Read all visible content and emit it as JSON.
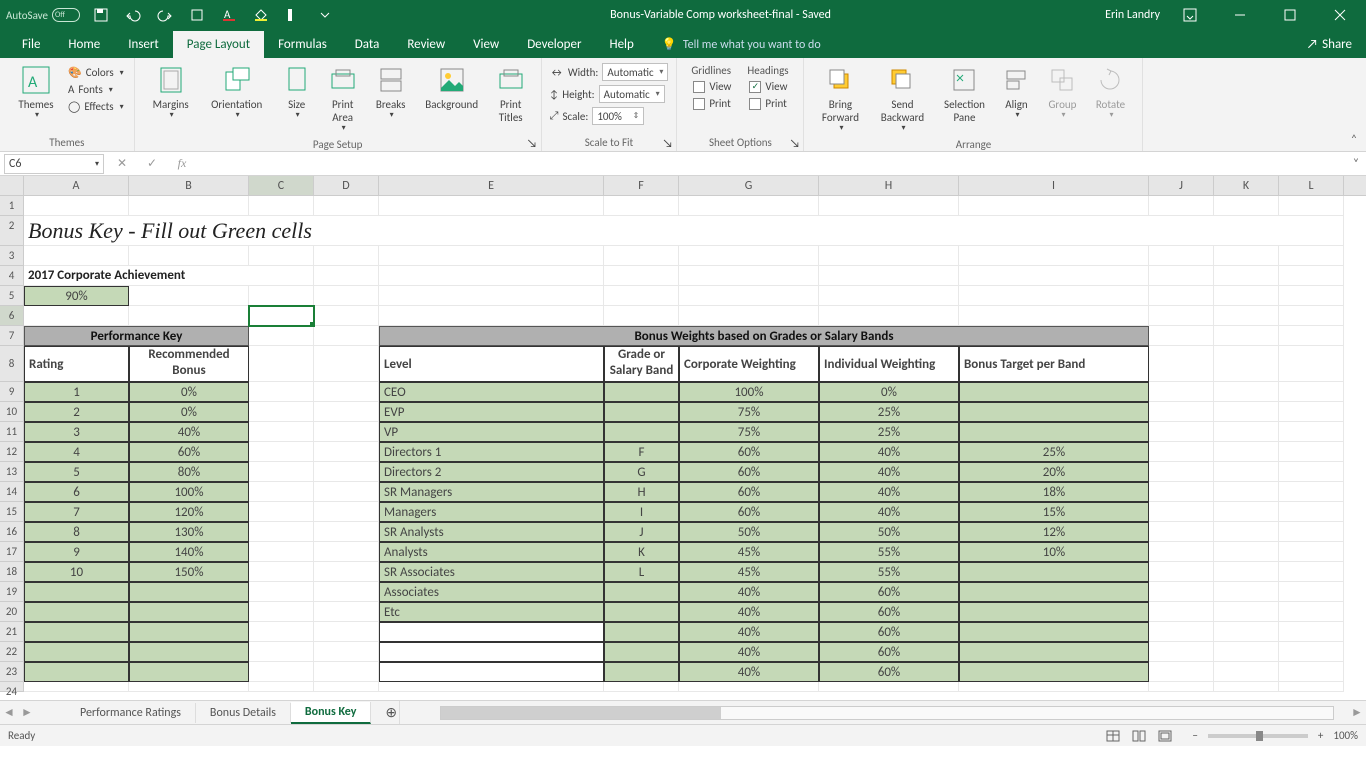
{
  "titlebar": {
    "autosave": "AutoSave",
    "doc": "Bonus-Variable Comp worksheet-final  -  Saved",
    "user": "Erin Landry"
  },
  "tabs": [
    "File",
    "Home",
    "Insert",
    "Page Layout",
    "Formulas",
    "Data",
    "Review",
    "View",
    "Developer",
    "Help"
  ],
  "active_tab": "Page Layout",
  "tellme": "Tell me what you want to do",
  "share": "Share",
  "ribbon": {
    "themes": {
      "btn": "Themes",
      "colors": "Colors",
      "fonts": "Fonts",
      "effects": "Effects",
      "label": "Themes"
    },
    "page_setup": {
      "margins": "Margins",
      "orientation": "Orientation",
      "size": "Size",
      "printarea": "Print\nArea",
      "breaks": "Breaks",
      "background": "Background",
      "printtitles": "Print\nTitles",
      "label": "Page Setup"
    },
    "scale": {
      "width": "Width:",
      "width_v": "Automatic",
      "height": "Height:",
      "height_v": "Automatic",
      "scale": "Scale:",
      "scale_v": "100%",
      "label": "Scale to Fit"
    },
    "sheet": {
      "gridlines": "Gridlines",
      "headings": "Headings",
      "view": "View",
      "print": "Print",
      "label": "Sheet Options"
    },
    "arrange": {
      "bf": "Bring\nForward",
      "sb": "Send\nBackward",
      "sp": "Selection\nPane",
      "align": "Align",
      "group": "Group",
      "rotate": "Rotate",
      "label": "Arrange"
    }
  },
  "formula": {
    "namebox": "C6"
  },
  "cols": [
    "A",
    "B",
    "C",
    "D",
    "E",
    "F",
    "G",
    "H",
    "I",
    "J",
    "K",
    "L"
  ],
  "sheet": {
    "title": "Bonus Key - Fill out Green cells",
    "ach_label": "2017 Corporate Achievement",
    "ach_val": "90%",
    "perf": {
      "header": "Performance Key",
      "c1": "Rating",
      "c2": "Recommended\nBonus",
      "rows": [
        {
          "r": "1",
          "b": "0%"
        },
        {
          "r": "2",
          "b": "0%"
        },
        {
          "r": "3",
          "b": "40%"
        },
        {
          "r": "4",
          "b": "60%"
        },
        {
          "r": "5",
          "b": "80%"
        },
        {
          "r": "6",
          "b": "100%"
        },
        {
          "r": "7",
          "b": "120%"
        },
        {
          "r": "8",
          "b": "130%"
        },
        {
          "r": "9",
          "b": "140%"
        },
        {
          "r": "10",
          "b": "150%"
        }
      ]
    },
    "bonus": {
      "header": "Bonus Weights based on Grades or Salary Bands",
      "cols": [
        "Level",
        "Grade or\nSalary Band",
        "Corporate Weighting",
        "Individual Weighting",
        "Bonus Target per Band"
      ],
      "rows": [
        {
          "l": "CEO",
          "g": "",
          "cw": "100%",
          "iw": "0%",
          "bt": ""
        },
        {
          "l": "EVP",
          "g": "",
          "cw": "75%",
          "iw": "25%",
          "bt": ""
        },
        {
          "l": "VP",
          "g": "",
          "cw": "75%",
          "iw": "25%",
          "bt": ""
        },
        {
          "l": "Directors 1",
          "g": "F",
          "cw": "60%",
          "iw": "40%",
          "bt": "25%"
        },
        {
          "l": "Directors 2",
          "g": "G",
          "cw": "60%",
          "iw": "40%",
          "bt": "20%"
        },
        {
          "l": "SR Managers",
          "g": "H",
          "cw": "60%",
          "iw": "40%",
          "bt": "18%"
        },
        {
          "l": "Managers",
          "g": "I",
          "cw": "60%",
          "iw": "40%",
          "bt": "15%"
        },
        {
          "l": "SR Analysts",
          "g": "J",
          "cw": "50%",
          "iw": "50%",
          "bt": "12%"
        },
        {
          "l": "Analysts",
          "g": "K",
          "cw": "45%",
          "iw": "55%",
          "bt": "10%"
        },
        {
          "l": "SR Associates",
          "g": "L",
          "cw": "45%",
          "iw": "55%",
          "bt": ""
        },
        {
          "l": "Associates",
          "g": "",
          "cw": "40%",
          "iw": "60%",
          "bt": ""
        },
        {
          "l": "Etc",
          "g": "",
          "cw": "40%",
          "iw": "60%",
          "bt": ""
        },
        {
          "l": "",
          "g": "",
          "cw": "40%",
          "iw": "60%",
          "bt": "",
          "whiteE": true
        },
        {
          "l": "",
          "g": "",
          "cw": "40%",
          "iw": "60%",
          "bt": "",
          "whiteE": true
        },
        {
          "l": "",
          "g": "",
          "cw": "40%",
          "iw": "60%",
          "bt": "",
          "whiteE": true
        }
      ]
    }
  },
  "sheettabs": [
    "Performance Ratings",
    "Bonus Details",
    "Bonus Key"
  ],
  "active_sheet": "Bonus Key",
  "status": {
    "ready": "Ready",
    "zoom": "100%"
  }
}
